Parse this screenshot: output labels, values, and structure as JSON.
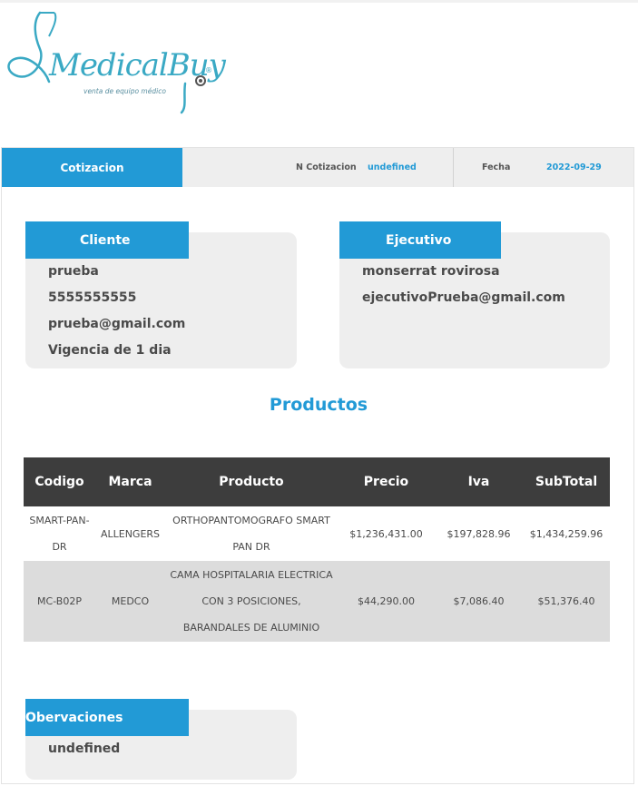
{
  "logo": {
    "brand": "MedicalBuy",
    "tagline": "venta de equipo médico",
    "registered": "®",
    "icon": "stethoscope-icon",
    "color": "#3aa9c4"
  },
  "header": {
    "tab_label": "Cotizacion",
    "quote_number_label": "N Cotizacion",
    "quote_number_value": "undefined",
    "date_label": "Fecha",
    "date_value": "2022-09-29"
  },
  "client": {
    "title": "Cliente",
    "name": "prueba",
    "phone": "5555555555",
    "email": "prueba@gmail.com",
    "validity": "Vigencia de 1 dia"
  },
  "executive": {
    "title": "Ejecutivo",
    "name": "monserrat rovirosa",
    "email": "ejecutivoPrueba@gmail.com"
  },
  "products": {
    "title": "Productos",
    "columns": [
      "Codigo",
      "Marca",
      "Producto",
      "Precio",
      "Iva",
      "SubTotal"
    ],
    "rows": [
      [
        "SMART-PAN-DR",
        "ALLENGERS",
        "ORTHOPANTOMOGRAFO SMART PAN DR",
        "$1,236,431.00",
        "$197,828.96",
        "$1,434,259.96"
      ],
      [
        "MC-B02P",
        "MEDCO",
        "CAMA HOSPITALARIA ELECTRICA CON 3 POSICIONES, BARANDALES DE ALUMINIO",
        "$44,290.00",
        "$7,086.40",
        "$51,376.40"
      ]
    ]
  },
  "observations": {
    "title": "Obervaciones",
    "value": "undefined"
  },
  "colors": {
    "accent": "#229ad6",
    "table_header": "#3d3d3d",
    "card_background": "#eeeeee",
    "alt_row": "#dcdcdc"
  }
}
